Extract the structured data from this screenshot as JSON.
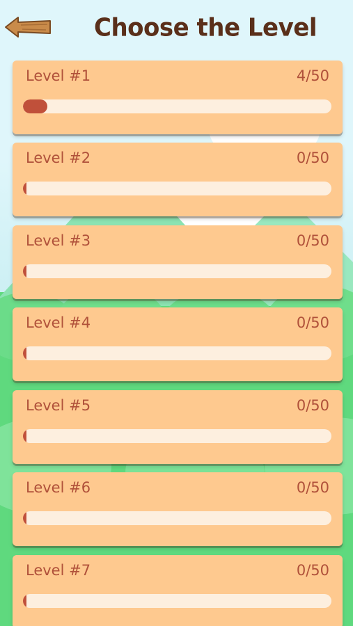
{
  "header": {
    "title": "Choose the Level",
    "back_icon": "wooden-arrow-left-icon"
  },
  "colors": {
    "card_background": "#fec98f",
    "text": "#b0513a",
    "progress_fill": "#c0503a",
    "progress_track": "#fdefdf",
    "title": "#5a2f1a",
    "grass": "#5fd97e",
    "sky": "#dff6fb"
  },
  "levels": [
    {
      "label": "Level #1",
      "count": "4/50",
      "progress": 0.08
    },
    {
      "label": "Level #2",
      "count": "0/50",
      "progress": 0
    },
    {
      "label": "Level #3",
      "count": "0/50",
      "progress": 0
    },
    {
      "label": "Level #4",
      "count": "0/50",
      "progress": 0
    },
    {
      "label": "Level #5",
      "count": "0/50",
      "progress": 0
    },
    {
      "label": "Level #6",
      "count": "0/50",
      "progress": 0
    },
    {
      "label": "Level #7",
      "count": "0/50",
      "progress": 0
    }
  ]
}
